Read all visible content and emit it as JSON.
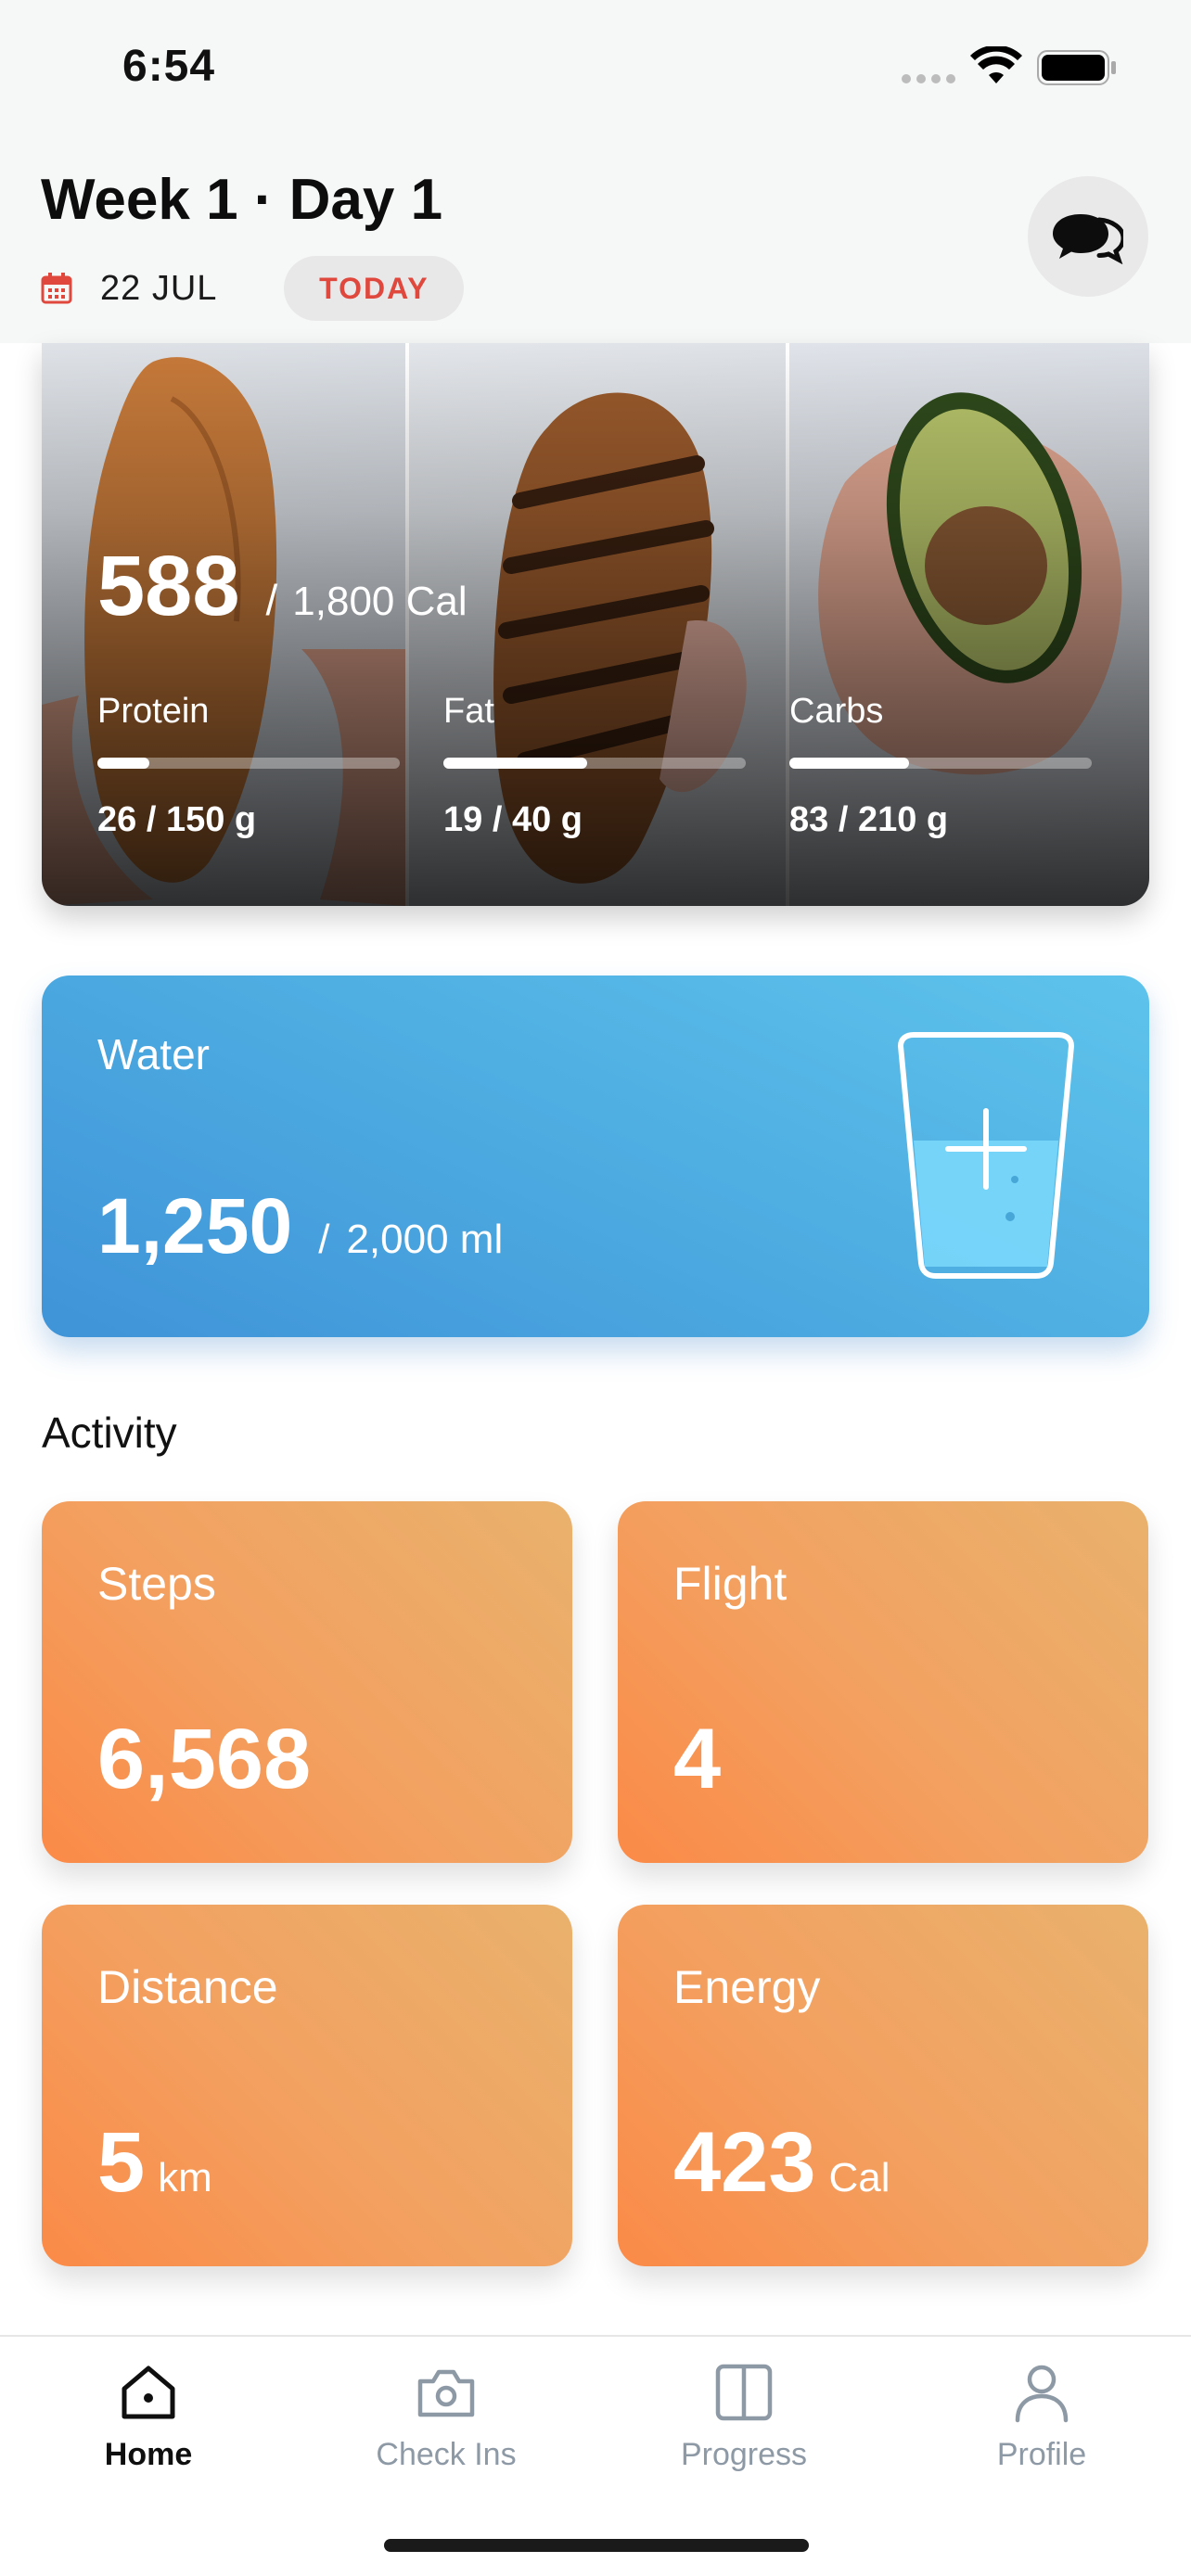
{
  "status_bar": {
    "time": "6:54"
  },
  "header": {
    "title": "Week 1 · Day 1",
    "date": "22 JUL",
    "today_label": "TODAY",
    "calendar_icon": "calendar-icon",
    "chat_icon": "chat-bubbles-icon"
  },
  "nutrition": {
    "calories": "588",
    "calories_target": "1,800 Cal",
    "photos": [
      "sweet-potato-photo",
      "grilled-chicken-photo",
      "avocado-photo"
    ],
    "macros": [
      {
        "label": "Protein",
        "value": "26 / 150 g",
        "progress": 0.173
      },
      {
        "label": "Fat",
        "value": "19 / 40 g",
        "progress": 0.475
      },
      {
        "label": "Carbs",
        "value": "83 / 210 g",
        "progress": 0.395
      }
    ]
  },
  "water": {
    "title": "Water",
    "value": "1,250",
    "target": "2,000 ml",
    "icon": "water-glass-add-icon",
    "colors": {
      "start": "#3f93d8",
      "end": "#5ec4ec"
    }
  },
  "activity": {
    "title": "Activity",
    "tiles": [
      {
        "title": "Steps",
        "value": "6,568",
        "unit": ""
      },
      {
        "title": "Flight",
        "value": "4",
        "unit": ""
      },
      {
        "title": "Distance",
        "value": "5",
        "unit": "km"
      },
      {
        "title": "Energy",
        "value": "423",
        "unit": "Cal"
      }
    ],
    "colors": {
      "start": "#e9b26d",
      "end": "#fb8a47"
    }
  },
  "tab_bar": {
    "tabs": [
      {
        "label": "Home",
        "icon": "home-icon",
        "active": true
      },
      {
        "label": "Check Ins",
        "icon": "camera-icon",
        "active": false
      },
      {
        "label": "Progress",
        "icon": "split-panel-icon",
        "active": false
      },
      {
        "label": "Profile",
        "icon": "person-icon",
        "active": false
      }
    ]
  },
  "accent_color": "#e0483e"
}
